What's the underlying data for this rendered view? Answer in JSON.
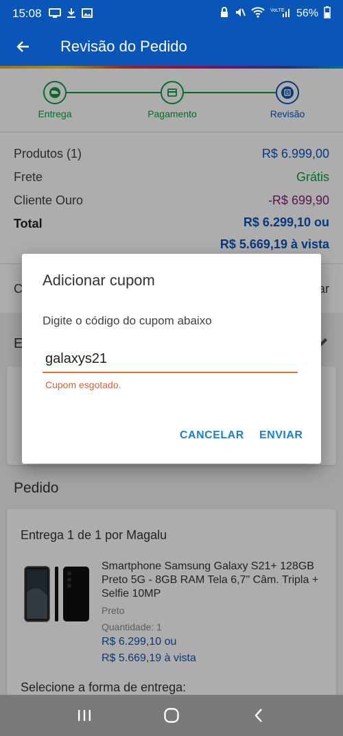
{
  "status_bar": {
    "time": "15:08",
    "battery": "56%"
  },
  "app_bar": {
    "title": "Revisão do Pedido"
  },
  "stepper": {
    "steps": [
      {
        "label": "Entrega"
      },
      {
        "label": "Pagamento"
      },
      {
        "label": "Revisão"
      }
    ]
  },
  "summary": {
    "produtos_label": "Produtos (1)",
    "produtos_value": "R$ 6.999,00",
    "frete_label": "Frete",
    "frete_value": "Grátis",
    "cliente_label": "Cliente Ouro",
    "cliente_value": "-R$ 699,90",
    "total_label": "Total",
    "total_line1": "R$ 6.299,10 ou",
    "total_line2": "R$ 5.669,19 à vista"
  },
  "background": {
    "cupom_left": "C",
    "cupom_right": "ar",
    "endereco_letter": "E",
    "pedido_title": "Pedido"
  },
  "order": {
    "heading": "Entrega 1 de 1 por Magalu",
    "product_name": "Smartphone Samsung Galaxy S21+ 128GB Preto 5G - 8GB RAM Tela 6,7\" Câm. Tripla + Selfie 10MP",
    "color": "Preto",
    "quantity": "Quantidade:  1",
    "price_line1": "R$ 6.299,10 ou",
    "price_line2": "R$ 5.669,19 à vista",
    "delivery_label": "Selecione a forma de entrega:"
  },
  "dialog": {
    "title": "Adicionar cupom",
    "subtitle": "Digite o código do cupom abaixo",
    "input_value": "galaxys21",
    "error": "Cupom esgotado.",
    "cancel_label": "CANCELAR",
    "send_label": "ENVIAR"
  },
  "colors": {
    "primary": "#0a55b8",
    "green": "#0a9c40",
    "purple": "#8c1a7a",
    "error": "#e0602a",
    "button": "#1a7fcf"
  }
}
